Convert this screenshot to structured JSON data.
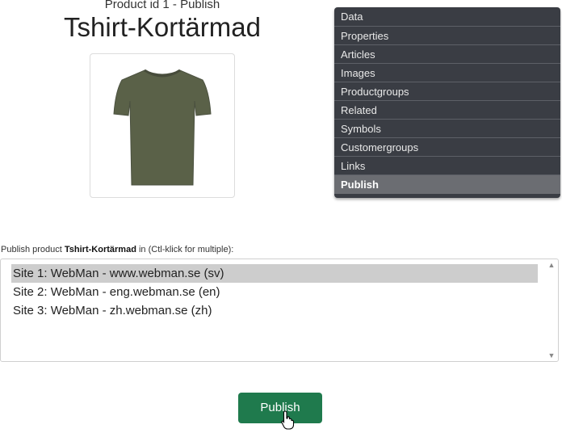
{
  "header": {
    "subtitle": "Product id 1 - Publish",
    "title": "Tshirt-Kortärmad"
  },
  "tabs": [
    {
      "label": "Data",
      "active": false
    },
    {
      "label": "Properties",
      "active": false
    },
    {
      "label": "Articles",
      "active": false
    },
    {
      "label": "Images",
      "active": false
    },
    {
      "label": "Productgroups",
      "active": false
    },
    {
      "label": "Related",
      "active": false
    },
    {
      "label": "Symbols",
      "active": false
    },
    {
      "label": "Customergroups",
      "active": false
    },
    {
      "label": "Links",
      "active": false
    },
    {
      "label": "Publish",
      "active": true
    }
  ],
  "publish_form": {
    "label_prefix": "Publish product ",
    "product_name": "Tshirt-Kortärmad",
    "label_suffix": " in (Ctl-klick for multiple):",
    "sites": [
      {
        "label": "Site 1: WebMan - www.webman.se (sv)",
        "selected": true
      },
      {
        "label": "Site 2: WebMan - eng.webman.se (en)",
        "selected": false
      },
      {
        "label": "Site 3: WebMan - zh.webman.se (zh)",
        "selected": false
      }
    ],
    "button_label": "Publish"
  },
  "colors": {
    "button": "#1f7a4d",
    "tabs_bg": "#3a3d44",
    "tab_active": "#6b6d72",
    "shirt": "#5a6148"
  },
  "icons": {
    "product_image": "tshirt-image",
    "cursor": "hand-pointer-icon"
  }
}
